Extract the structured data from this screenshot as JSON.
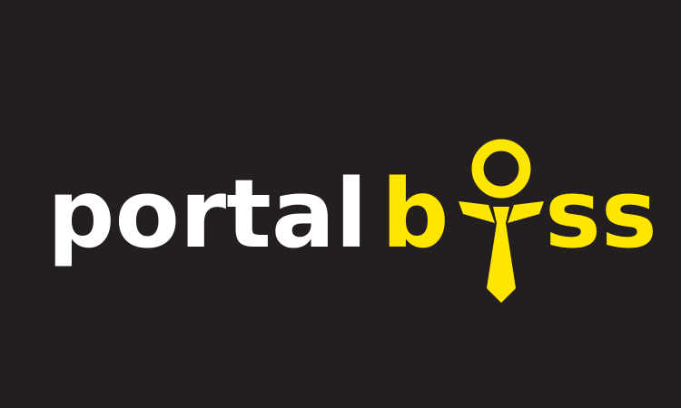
{
  "logo": {
    "wordmark_part1": "portal",
    "wordmark_part2": "boss",
    "wordmark_full": "portalboss"
  },
  "colors": {
    "background": "#231f20",
    "primary_text": "#ffffff",
    "accent": "#ffe600"
  }
}
